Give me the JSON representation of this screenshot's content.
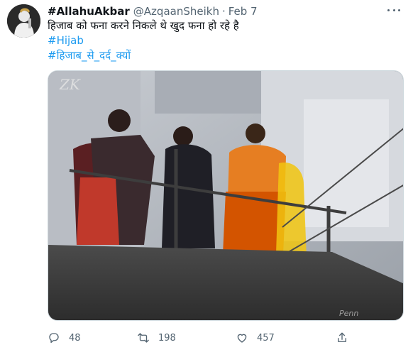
{
  "tweet": {
    "display_name": "#AllahuAkbar",
    "handle": "@AzqaanSheikh",
    "separator": "·",
    "timestamp": "Feb 7",
    "text_line": "हिजाब को फना करने निकले थे खुद फना हो रहे है",
    "hashtags": [
      "#Hijab",
      "#हिजाब_से_दर्द_क्यों"
    ],
    "media": {
      "watermark_top": "ZK",
      "watermark_bottom": "Penn"
    },
    "actions": {
      "reply_count": "48",
      "retweet_count": "198",
      "like_count": "457"
    },
    "icons": {
      "more": "more-icon",
      "reply": "reply-icon",
      "retweet": "retweet-icon",
      "like": "heart-icon",
      "share": "share-icon"
    },
    "colors": {
      "link": "#1d9bf0",
      "secondary_text": "#536471"
    }
  }
}
